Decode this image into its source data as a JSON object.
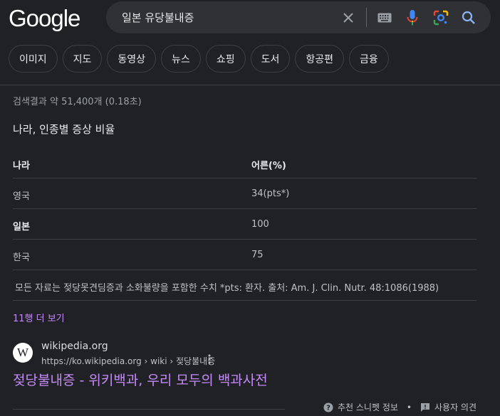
{
  "header": {
    "logo": "Google",
    "search": {
      "query": "일본 유당불내증"
    }
  },
  "chips": [
    "이미지",
    "지도",
    "동영상",
    "뉴스",
    "쇼핑",
    "도서",
    "항공편",
    "금융"
  ],
  "stats": "검색결과 약 51,400개 (0.18초)",
  "snippet": {
    "title": "나라, 인종별 증상 비율",
    "table": {
      "headers": [
        "나라",
        "어른(%)"
      ],
      "rows": [
        [
          "영국",
          "34(pts*)"
        ],
        [
          "일본",
          "100"
        ],
        [
          "한국",
          "75"
        ]
      ],
      "footnote": "모든 자료는 젖당못견딤증과 소화불량을 포함한 수치 *pts: 환자. 출처: Am. J. Clin. Nutr. 48:1086(1988)"
    },
    "more_link": "11행 더 보기"
  },
  "result": {
    "favicon": "W",
    "site_name": "wikipedia.org",
    "url": "https://ko.wikipedia.org › wiki › 젖당불내증",
    "title": "젖당불내증 - 위키백과, 우리 모두의 백과사전"
  },
  "footer": {
    "about": "추천 스니펫 정보",
    "separator": "•",
    "feedback": "사용자 의견"
  },
  "colors": {
    "background": "#202124",
    "link_visited": "#c58af9",
    "text": "#bdc1c6"
  }
}
